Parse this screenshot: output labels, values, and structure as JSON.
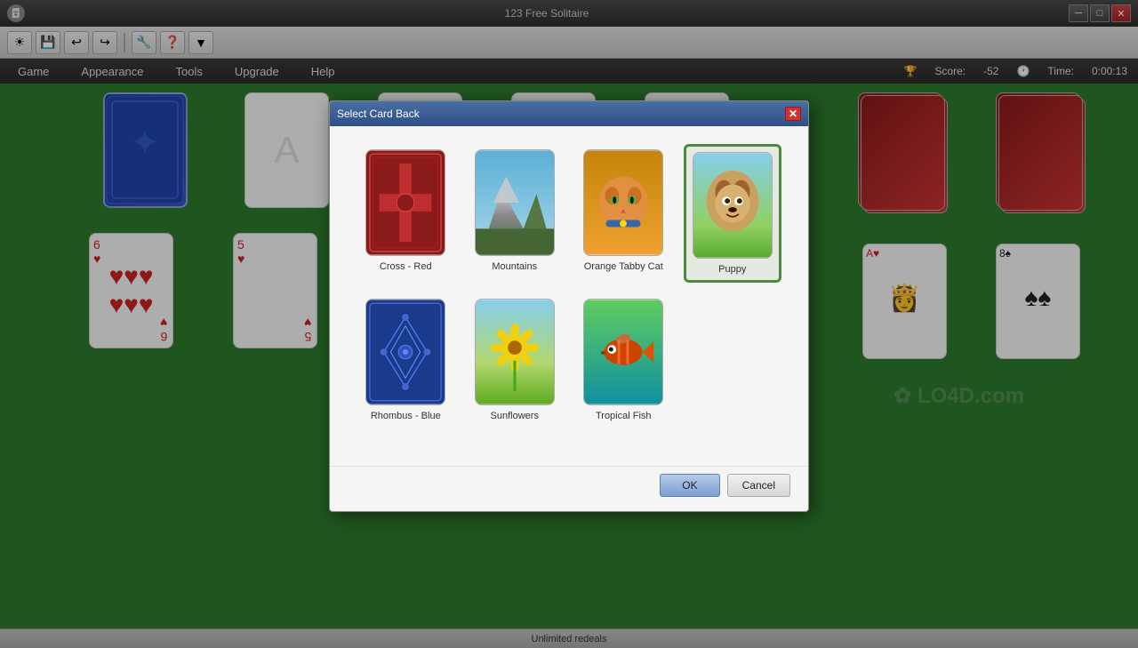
{
  "titlebar": {
    "title": "123 Free Solitaire",
    "minimize": "─",
    "maximize": "□",
    "close": "✕"
  },
  "toolbar": {
    "buttons": [
      "☀",
      "💾",
      "↩",
      "↪",
      "🔧",
      "❓",
      "▼"
    ]
  },
  "menubar": {
    "items": [
      "Game",
      "Appearance",
      "Tools",
      "Upgrade",
      "Help"
    ],
    "score_label": "Score:",
    "score_value": "-52",
    "time_label": "Time:",
    "time_value": "0:00:13"
  },
  "statusbar": {
    "text": "Unlimited redeals"
  },
  "dialog": {
    "title": "Select Card Back",
    "cards": [
      {
        "id": "cross-red",
        "label": "Cross - Red",
        "selected": false
      },
      {
        "id": "mountains",
        "label": "Mountains",
        "selected": false
      },
      {
        "id": "orange-tabby",
        "label": "Orange Tabby Cat",
        "selected": false
      },
      {
        "id": "puppy",
        "label": "Puppy",
        "selected": true
      },
      {
        "id": "rhombus-blue",
        "label": "Rhombus - Blue",
        "selected": false
      },
      {
        "id": "sunflowers",
        "label": "Sunflowers",
        "selected": false
      },
      {
        "id": "tropical-fish",
        "label": "Tropical Fish",
        "selected": false
      }
    ],
    "ok_label": "OK",
    "cancel_label": "Cancel"
  }
}
